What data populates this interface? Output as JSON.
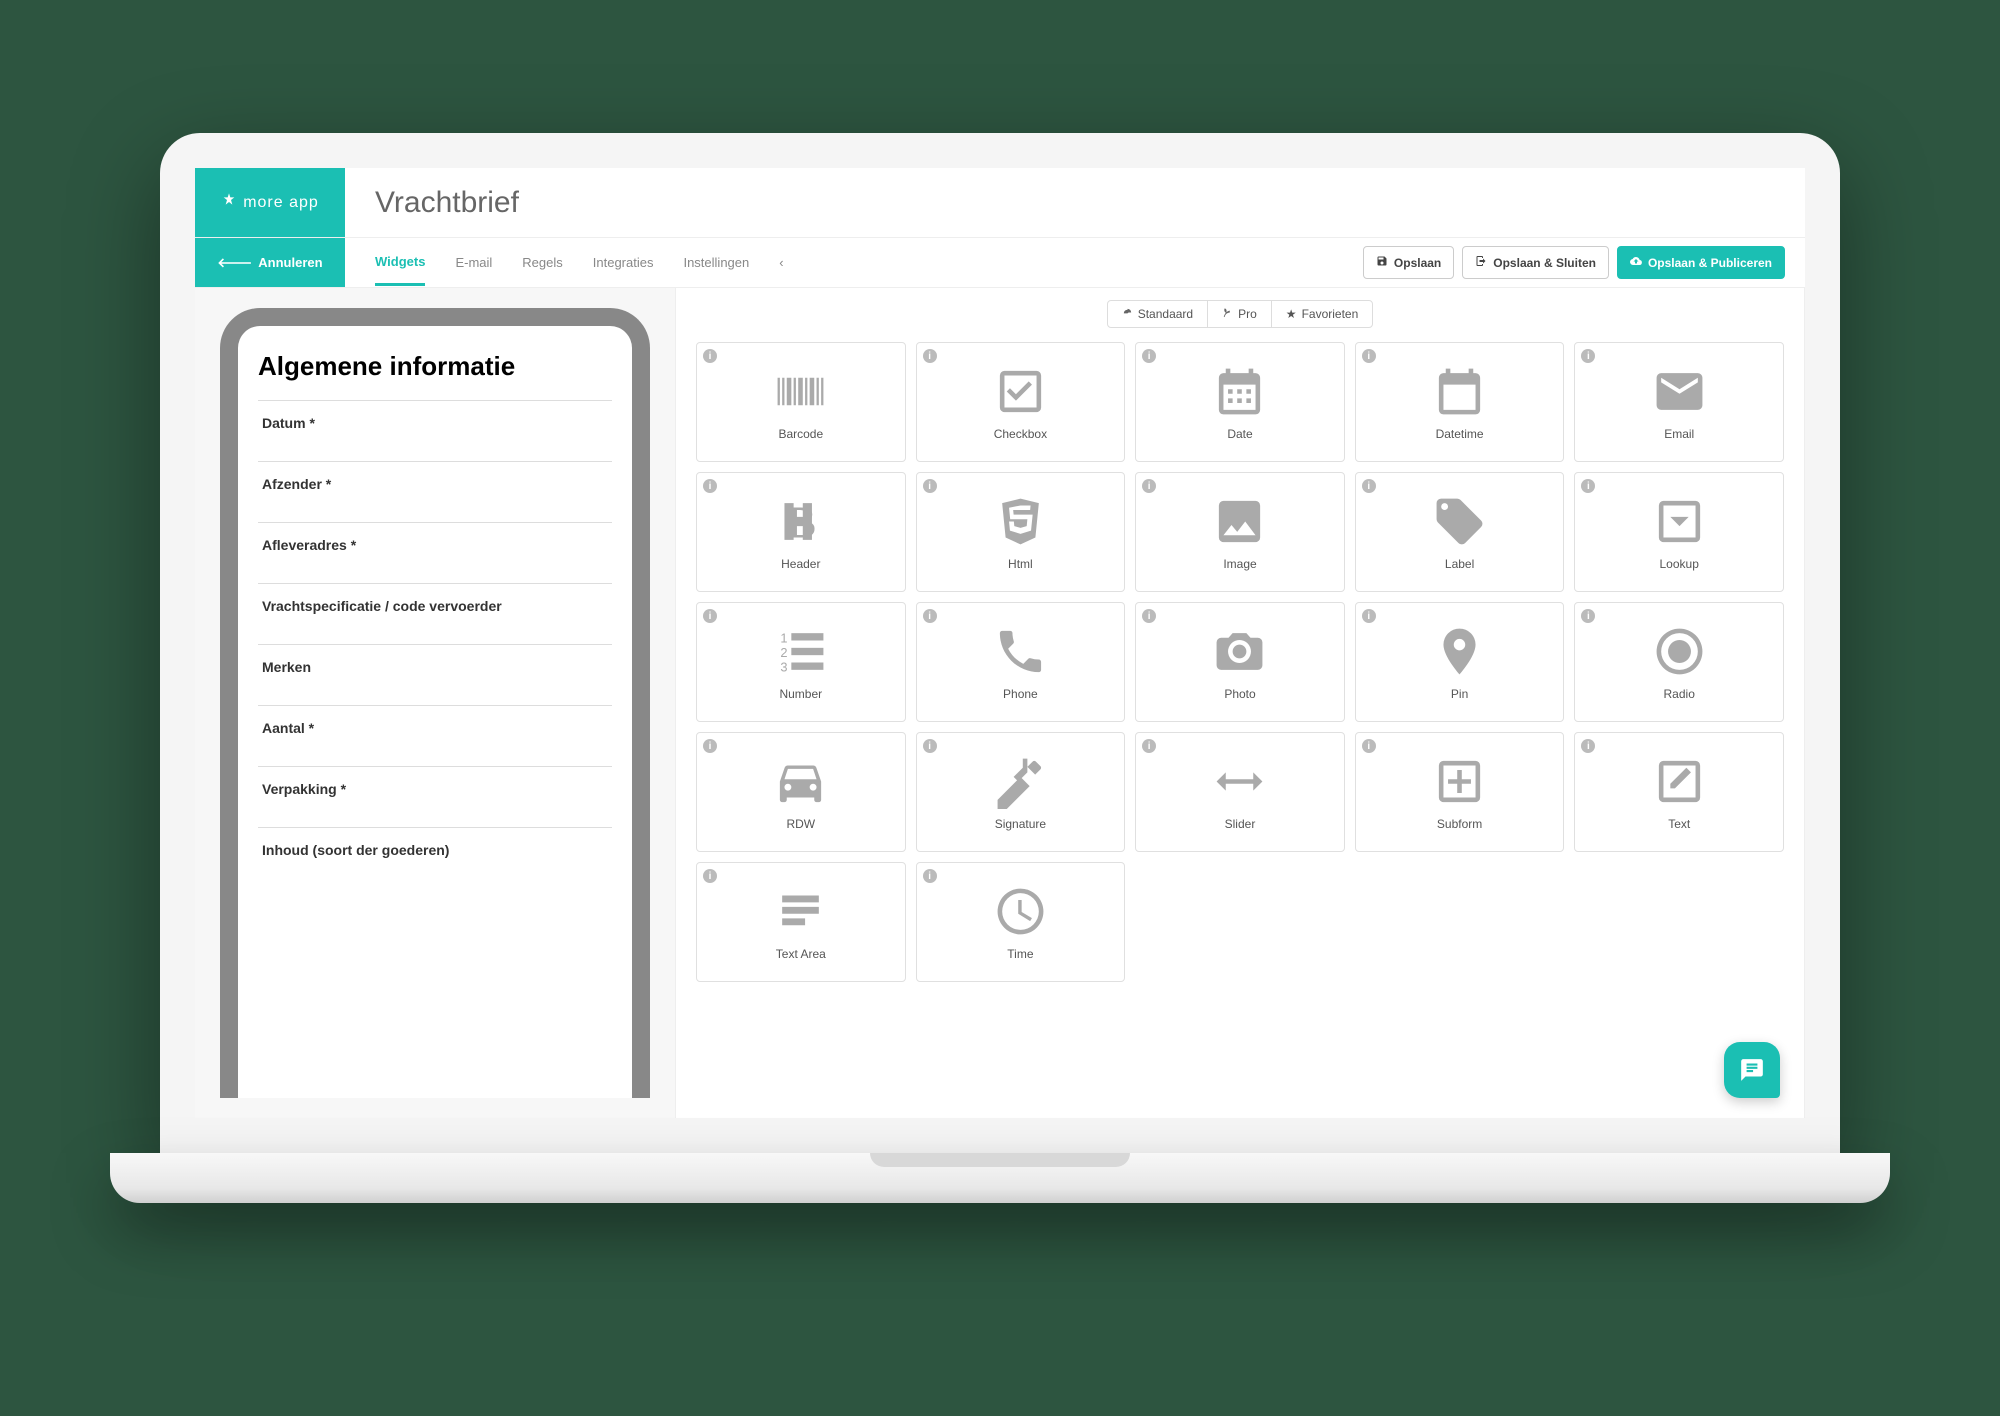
{
  "brand": {
    "name": "more app"
  },
  "page": {
    "title": "Vrachtbrief"
  },
  "cancel": {
    "label": "Annuleren"
  },
  "tabs": [
    {
      "label": "Widgets",
      "active": true
    },
    {
      "label": "E-mail",
      "active": false
    },
    {
      "label": "Regels",
      "active": false
    },
    {
      "label": "Integraties",
      "active": false
    },
    {
      "label": "Instellingen",
      "active": false
    }
  ],
  "actions": {
    "save": "Opslaan",
    "save_close": "Opslaan & Sluiten",
    "save_publish": "Opslaan & Publiceren"
  },
  "form": {
    "heading": "Algemene informatie",
    "fields": [
      {
        "label": "Datum *"
      },
      {
        "label": "Afzender *"
      },
      {
        "label": "Afleveradres *"
      },
      {
        "label": "Vrachtspecificatie / code vervoerder"
      },
      {
        "label": "Merken"
      },
      {
        "label": "Aantal *"
      },
      {
        "label": "Verpakking *"
      },
      {
        "label": "Inhoud (soort der goederen)"
      }
    ]
  },
  "widget_filters": [
    {
      "label": "Standaard",
      "icon": "dashboard"
    },
    {
      "label": "Pro",
      "icon": "leaf"
    },
    {
      "label": "Favorieten",
      "icon": "star"
    }
  ],
  "widgets": [
    {
      "label": "Barcode",
      "icon": "barcode"
    },
    {
      "label": "Checkbox",
      "icon": "checkbox"
    },
    {
      "label": "Date",
      "icon": "calendar-grid"
    },
    {
      "label": "Datetime",
      "icon": "calendar"
    },
    {
      "label": "Email",
      "icon": "email"
    },
    {
      "label": "Header",
      "icon": "header"
    },
    {
      "label": "Html",
      "icon": "html"
    },
    {
      "label": "Image",
      "icon": "image"
    },
    {
      "label": "Label",
      "icon": "label"
    },
    {
      "label": "Lookup",
      "icon": "lookup"
    },
    {
      "label": "Number",
      "icon": "number"
    },
    {
      "label": "Phone",
      "icon": "phone"
    },
    {
      "label": "Photo",
      "icon": "photo"
    },
    {
      "label": "Pin",
      "icon": "pin"
    },
    {
      "label": "Radio",
      "icon": "radio"
    },
    {
      "label": "RDW",
      "icon": "car"
    },
    {
      "label": "Signature",
      "icon": "signature"
    },
    {
      "label": "Slider",
      "icon": "slider"
    },
    {
      "label": "Subform",
      "icon": "subform"
    },
    {
      "label": "Text",
      "icon": "text"
    },
    {
      "label": "Text Area",
      "icon": "textarea"
    },
    {
      "label": "Time",
      "icon": "time"
    }
  ]
}
